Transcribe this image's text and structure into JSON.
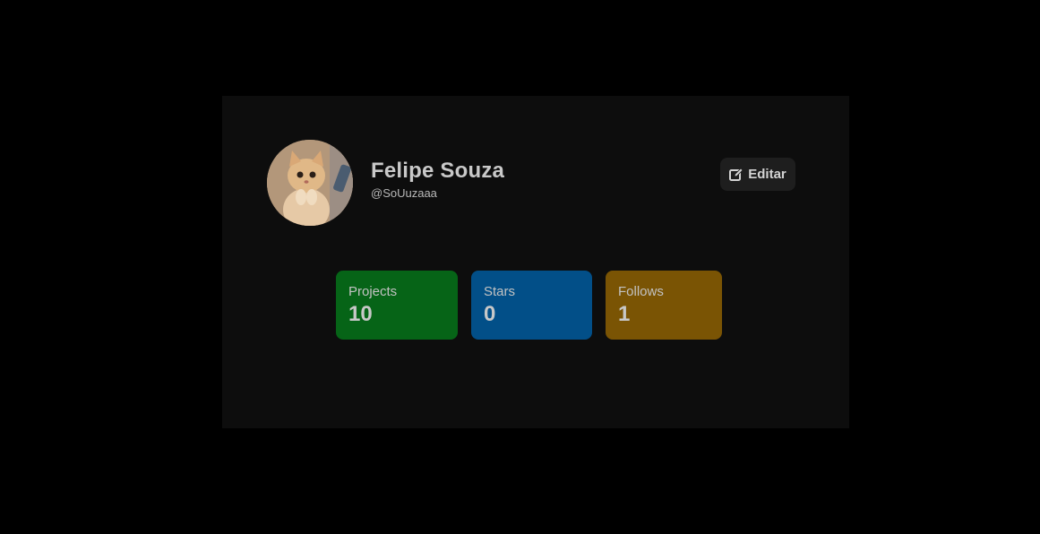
{
  "profile": {
    "name": "Felipe Souza",
    "handle": "@SoUuzaaa",
    "avatar_icon": "cat-photo"
  },
  "actions": {
    "edit_label": "Editar",
    "edit_icon": "edit-icon"
  },
  "stats": [
    {
      "label": "Projects",
      "value": "10",
      "color": "#066417"
    },
    {
      "label": "Stars",
      "value": "0",
      "color": "#024f88"
    },
    {
      "label": "Follows",
      "value": "1",
      "color": "#7a5404"
    }
  ],
  "colors": {
    "page_background": "#000000",
    "card_background": "#0d0d0d",
    "button_background": "#1e1e1e"
  }
}
